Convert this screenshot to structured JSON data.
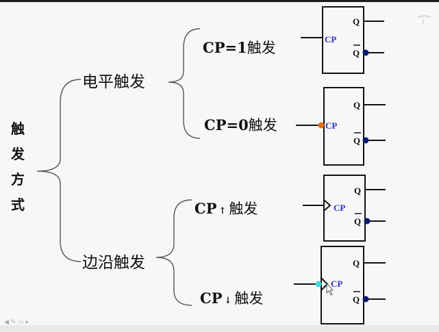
{
  "root": {
    "chars": [
      "触",
      "发",
      "方",
      "式"
    ]
  },
  "branch_level": {
    "label": "电平触发",
    "items": [
      {
        "main": "CP=1",
        "suffix": "触发"
      },
      {
        "main": "CP=0",
        "suffix": "触发"
      }
    ]
  },
  "branch_edge": {
    "label": "边沿触发",
    "items": [
      {
        "main": "CP",
        "arrow": "↑",
        "suffix": "触发"
      },
      {
        "main": "CP",
        "arrow": "↓",
        "suffix": "触发"
      }
    ]
  },
  "flipflop": {
    "cp": "CP",
    "q": "Q",
    "qbar": "Q"
  },
  "colors": {
    "cp_label": "#2e2ec8",
    "bubble": "#0a1a6e",
    "low_active_bubble": "#e0701e",
    "falling_edge_bubble": "#3fd8e0"
  },
  "icons": {
    "logo": "brand-logo-icon",
    "toolbar": "toolbar-icons"
  }
}
